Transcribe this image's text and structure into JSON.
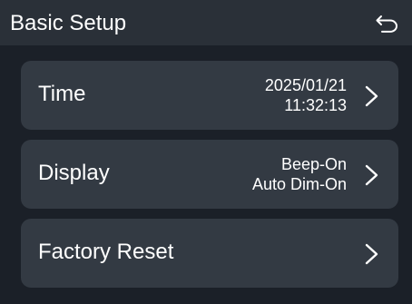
{
  "header": {
    "title": "Basic Setup",
    "back_icon": "back-arrow-icon"
  },
  "items": [
    {
      "label": "Time",
      "values": [
        "2025/01/21",
        "11:32:13"
      ],
      "icon": "chevron-right-icon"
    },
    {
      "label": "Display",
      "values": [
        "Beep-On",
        "Auto Dim-On"
      ],
      "icon": "chevron-right-icon"
    },
    {
      "label": "Factory Reset",
      "values": [],
      "icon": "chevron-right-icon"
    }
  ],
  "colors": {
    "background": "#1b2028",
    "header": "#2a3038",
    "item": "#333a43",
    "text": "#ffffff"
  }
}
